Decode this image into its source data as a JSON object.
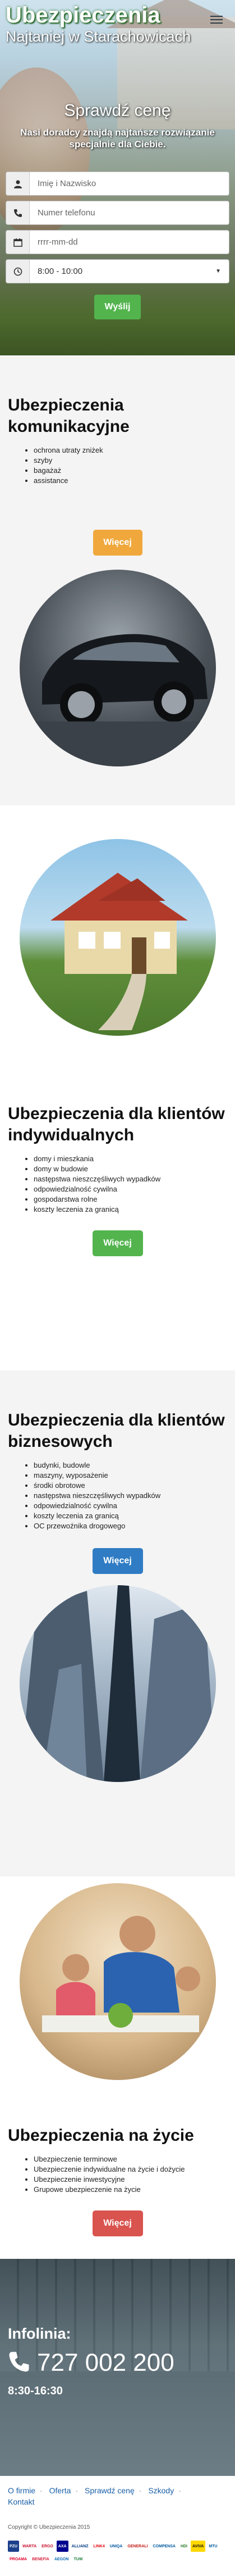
{
  "brand": {
    "name": "Ubezpieczenia",
    "tagline": "Najtaniej w Starachowicach"
  },
  "hero": {
    "title": "Sprawdź cenę",
    "subtitle": "Nasi doradcy znajdą najtańsze rozwiązanie specjalnie dla Ciebie."
  },
  "form": {
    "name_placeholder": "Imię i Nazwisko",
    "phone_placeholder": "Numer telefonu",
    "date_placeholder": "rrrr-mm-dd",
    "time_value": "8:00 - 10:00",
    "submit_label": "Wyślij"
  },
  "sections": [
    {
      "title": "Ubezpieczenia komunikacyjne",
      "items": [
        "ochrona utraty zniżek",
        "szyby",
        "bagażaż",
        "assistance"
      ],
      "button": "Więcej",
      "color": "#f0a83c"
    },
    {
      "title": "Ubezpieczenia dla klientów indywidualnych",
      "items": [
        "domy i mieszkania",
        "domy w budowie",
        "następstwa nieszczęśliwych wypadków",
        "odpowiedzialność cywilna",
        "gospodarstwa rolne",
        "koszty leczenia za granicą"
      ],
      "button": "Więcej",
      "color": "#53b44e"
    },
    {
      "title": "Ubezpieczenia dla klientów biznesowych",
      "items": [
        "budynki, budowle",
        "maszyny, wyposażenie",
        "środki obrotowe",
        "następstwa nieszczęśliwych wypadków",
        "odpowiedzialność cywilna",
        "koszty leczenia za granicą",
        "OC przewoźnika drogowego"
      ],
      "button": "Więcej",
      "color": "#2f7cc4"
    },
    {
      "title": "Ubezpieczenia na życie",
      "items": [
        "Ubezpieczenie terminowe",
        "Ubezpieczenie indywidualne na życie i dożycie",
        "Ubezpieczenie inwestycyjne",
        "Grupowe ubezpieczenie na życie"
      ],
      "button": "Więcej",
      "color": "#d9534f"
    }
  ],
  "contact": {
    "label": "Infolinia:",
    "phone": "727 002 200",
    "hours": "8:30-16:30"
  },
  "footer": {
    "nav": [
      "O firmie",
      "Oferta",
      "Sprawdź cenę",
      "Szkody",
      "Kontakt"
    ],
    "copyright": "Copyright © Ubezpieczenia 2015",
    "insurers": [
      "PZU",
      "WARTA",
      "ERGO",
      "AXA",
      "ALLIANZ",
      "LINK4",
      "UNIQA",
      "GENERALI",
      "COMPENSA",
      "HDI",
      "AVIVA",
      "MTU",
      "PROAMA",
      "BENEFIA",
      "AEGON",
      "TUW"
    ]
  },
  "colors": {
    "green": "#53b44e",
    "orange": "#f0a83c",
    "blue": "#2f7cc4",
    "red": "#d9534f",
    "link": "#1a5fa8"
  }
}
